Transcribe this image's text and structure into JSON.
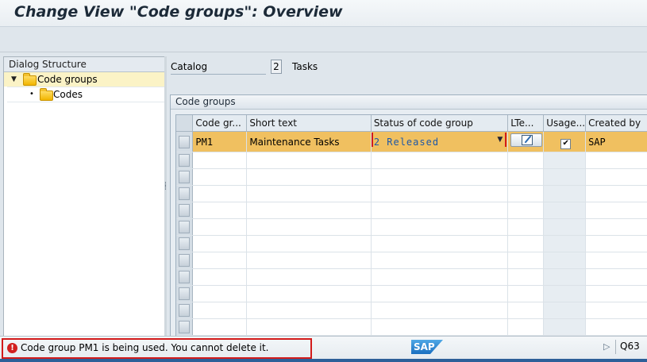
{
  "window": {
    "title": "Change View \"Code groups\": Overview"
  },
  "dialog_structure": {
    "header": "Dialog Structure",
    "items": [
      {
        "label": "Code groups",
        "icon": "folder-open-icon",
        "selected": true
      },
      {
        "label": "Codes",
        "icon": "folder-icon",
        "selected": false
      }
    ]
  },
  "catalog": {
    "label": "Catalog",
    "value": "2",
    "text": "Tasks"
  },
  "group": {
    "title": "Code groups",
    "columns": [
      "Code gr...",
      "Short text",
      "Status of code group",
      "LTe...",
      "Usage...",
      "Created by"
    ],
    "rows": [
      {
        "code": "PM1",
        "short_text": "Maintenance Tasks",
        "status": "2 Released",
        "usage_checked": "✔",
        "created_by": "SAP"
      }
    ]
  },
  "status_bar": {
    "message": "Code group PM1 is being used. You cannot delete it.",
    "logo": "SAP",
    "system": "Q63"
  },
  "colors": {
    "selected_row": "#f0c060",
    "error": "#d22020",
    "accent": "#2d5f99"
  }
}
